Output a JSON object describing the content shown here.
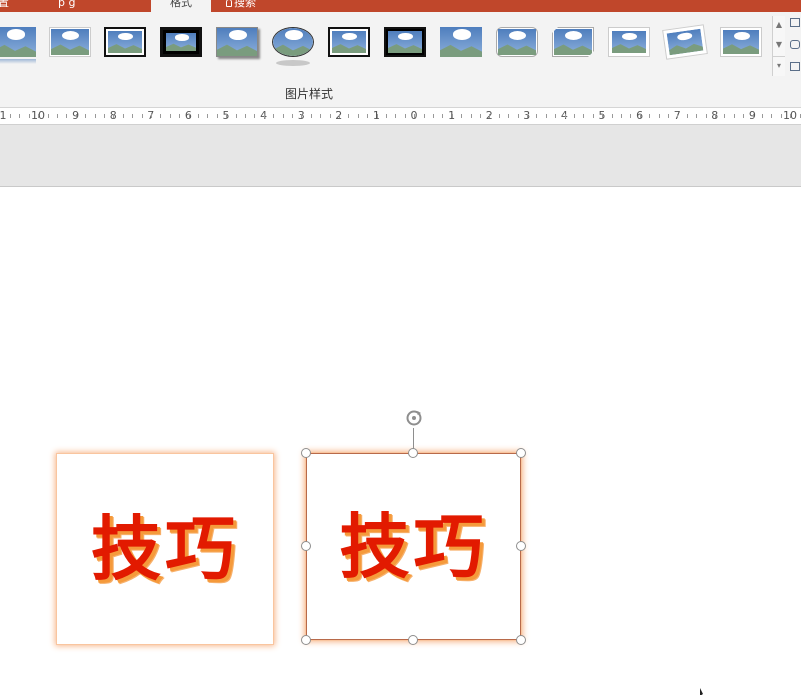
{
  "tabs": {
    "left1": "置",
    "left2": "p   g",
    "active": "格式",
    "tell": "搜索"
  },
  "ribbon": {
    "group_label": "图片样式",
    "styles": [
      "style-simple-frame-white",
      "style-beveled-matte-white",
      "style-metal-frame",
      "style-double-frame-black",
      "style-thick-matte-black",
      "style-simple-frame-black",
      "style-oval-reflected",
      "style-compound-frame-black",
      "style-drop-shadow-black",
      "style-soft-edge-rectangle",
      "style-rounded-diagonal-corner",
      "style-snip-diagonal-corner",
      "style-moderate-frame-white",
      "style-rotated-white",
      "style-perspective-shadow"
    ],
    "scroll_up": "▲",
    "scroll_down": "▼",
    "scroll_more": "▾"
  },
  "ruler": {
    "labels": [
      "1",
      "10",
      "9",
      "8",
      "7",
      "6",
      "5",
      "4",
      "3",
      "2",
      "1",
      "0",
      "1",
      "2",
      "3",
      "4",
      "5",
      "6",
      "7",
      "8",
      "9",
      "10"
    ]
  },
  "slide": {
    "left_image_text": "技巧",
    "right_image_text": "技巧"
  },
  "colors": {
    "accent_bar": "#c0472b",
    "glow": "#f7b68a",
    "text_red": "#e21a00"
  }
}
